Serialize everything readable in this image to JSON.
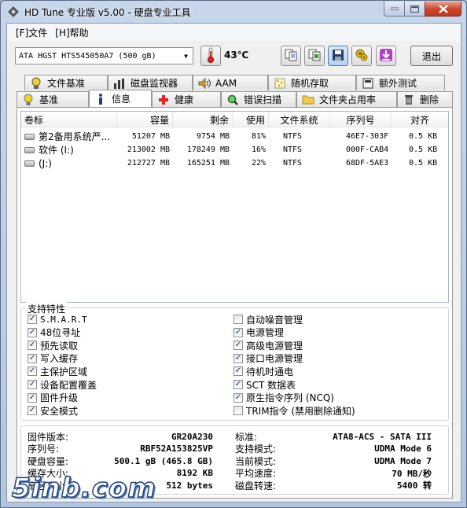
{
  "window": {
    "title": "HD Tune 专业版 v5.00 - 硬盘专业工具"
  },
  "menu": [
    "[F]文件",
    "[H]帮助"
  ],
  "toolbar": {
    "drive": "ATA    HGST HTS545050A7 (500 gB)",
    "temperature": "43℃",
    "exit_label": "退出",
    "buttons": [
      "copy-text-icon",
      "copy-screenshot-icon",
      "save-icon",
      "options-icon",
      "download-icon"
    ]
  },
  "tabs": {
    "row1": [
      "文件基准",
      "磁盘监视器",
      "AAM",
      "随机存取",
      "额外测试"
    ],
    "row2": [
      "基准",
      "信息",
      "健康",
      "错误扫描",
      "文件夹占用率",
      "删除"
    ],
    "selected": "信息"
  },
  "partitions": {
    "columns": [
      "卷标",
      "容量",
      "剩余",
      "使用",
      "文件系统",
      "序列号",
      "对齐"
    ],
    "rows": [
      [
        "第2备用系统严...",
        "51207 MB",
        "9754 MB",
        "81%",
        "NTFS",
        "46E7-303F",
        "0.5 KB"
      ],
      [
        "软件 (I:)",
        "213002 MB",
        "178249 MB",
        "16%",
        "NTFS",
        "000F-CAB4",
        "0.5 KB"
      ],
      [
        "(J:)",
        "212727 MB",
        "165251 MB",
        "22%",
        "NTFS",
        "68DF-5AE3",
        "0.5 KB"
      ]
    ]
  },
  "features": {
    "legend": "支持特性",
    "left": [
      {
        "label": "S.M.A.R.T",
        "checked": true
      },
      {
        "label": "48位寻址",
        "checked": true
      },
      {
        "label": "预先读取",
        "checked": true
      },
      {
        "label": "写入缓存",
        "checked": true
      },
      {
        "label": "主保护区域",
        "checked": true
      },
      {
        "label": "设备配置覆盖",
        "checked": true
      },
      {
        "label": "固件升级",
        "checked": true
      },
      {
        "label": "安全模式",
        "checked": true
      }
    ],
    "right": [
      {
        "label": "自动噪音管理",
        "checked": false
      },
      {
        "label": "电源管理",
        "checked": true
      },
      {
        "label": "高级电源管理",
        "checked": true
      },
      {
        "label": "接口电源管理",
        "checked": true
      },
      {
        "label": "待机时通电",
        "checked": true
      },
      {
        "label": "SCT 数据表",
        "checked": true
      },
      {
        "label": "原生指令序列 (NCQ)",
        "checked": true
      },
      {
        "label": "TRIM指令 (禁用删除通知)",
        "checked": false
      }
    ]
  },
  "info": {
    "left": [
      {
        "label": "固件版本:",
        "value": "GR20A230"
      },
      {
        "label": "序列号:",
        "value": "RBF52A153825VP"
      },
      {
        "label": "硬盘容量:",
        "value": "500.1 gB (465.8 GB)"
      },
      {
        "label": "缓存大小:",
        "value": "8192 KB"
      },
      {
        "label": "扇区大小:",
        "value": "512 bytes"
      }
    ],
    "right": [
      {
        "label": "标准:",
        "value": "ATA8-ACS - SATA III"
      },
      {
        "label": "支持模式:",
        "value": "UDMA Mode 6"
      },
      {
        "label": "当前模式:",
        "value": "UDMA Mode 7"
      },
      {
        "label": "平均速度:",
        "value": "70 MB/秒"
      },
      {
        "label": "磁盘转速:",
        "value": "5400 转"
      }
    ]
  },
  "watermark": "5inb.com"
}
